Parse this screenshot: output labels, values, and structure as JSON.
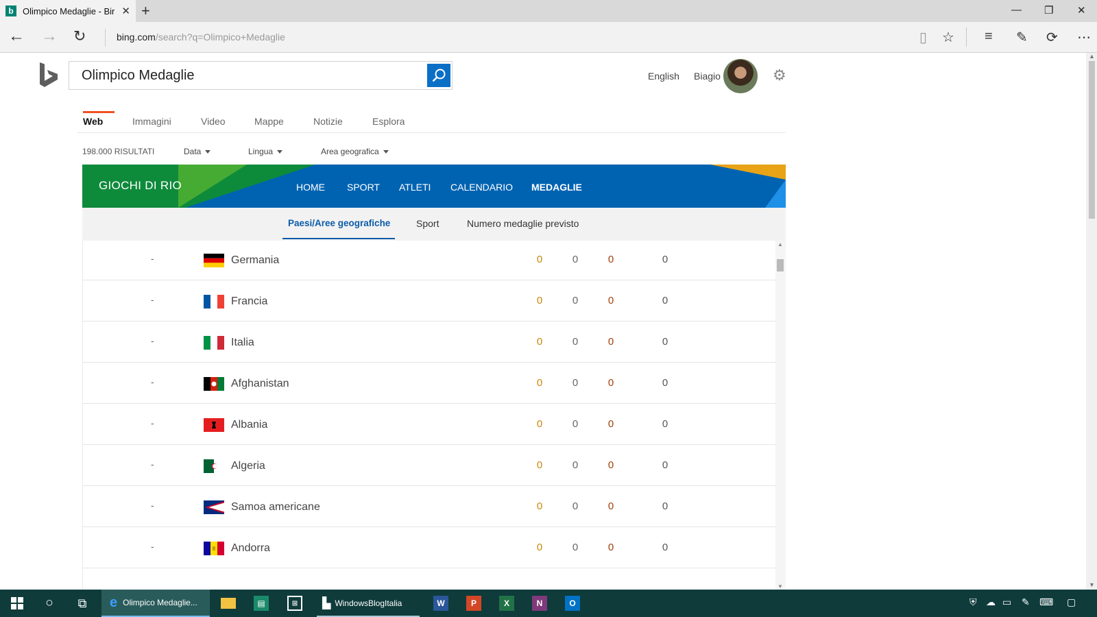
{
  "browser": {
    "tab_title": "Olimpico Medaglie - Bir",
    "url_host": "bing.com",
    "url_path": "/search?q=Olimpico+Medaglie"
  },
  "header": {
    "search_value": "Olimpico Medaglie",
    "language_link": "English",
    "user_name": "Biagio"
  },
  "scopes": [
    "Web",
    "Immagini",
    "Video",
    "Mappe",
    "Notizie",
    "Esplora"
  ],
  "filters": {
    "results_count": "198.000 RISULTATI",
    "date": "Data",
    "language": "Lingua",
    "region": "Area geografica"
  },
  "olympics": {
    "title": "GIOCHI DI RIO",
    "nav": [
      "HOME",
      "SPORT",
      "ATLETI",
      "CALENDARIO",
      "MEDAGLIE"
    ],
    "subtabs": [
      "Paesi/Aree geografiche",
      "Sport",
      "Numero medaglie previsto"
    ],
    "rows": [
      {
        "rank": "-",
        "country": "Germania",
        "gold": "0",
        "silver": "0",
        "bronze": "0",
        "total": "0",
        "flag": "germany"
      },
      {
        "rank": "-",
        "country": "Francia",
        "gold": "0",
        "silver": "0",
        "bronze": "0",
        "total": "0",
        "flag": "france"
      },
      {
        "rank": "-",
        "country": "Italia",
        "gold": "0",
        "silver": "0",
        "bronze": "0",
        "total": "0",
        "flag": "italy"
      },
      {
        "rank": "-",
        "country": "Afghanistan",
        "gold": "0",
        "silver": "0",
        "bronze": "0",
        "total": "0",
        "flag": "afghanistan"
      },
      {
        "rank": "-",
        "country": "Albania",
        "gold": "0",
        "silver": "0",
        "bronze": "0",
        "total": "0",
        "flag": "albania"
      },
      {
        "rank": "-",
        "country": "Algeria",
        "gold": "0",
        "silver": "0",
        "bronze": "0",
        "total": "0",
        "flag": "algeria"
      },
      {
        "rank": "-",
        "country": "Samoa americane",
        "gold": "0",
        "silver": "0",
        "bronze": "0",
        "total": "0",
        "flag": "american-samoa"
      },
      {
        "rank": "-",
        "country": "Andorra",
        "gold": "0",
        "silver": "0",
        "bronze": "0",
        "total": "0",
        "flag": "andorra"
      }
    ]
  },
  "taskbar": {
    "edge_label": "Olimpico Medaglie...",
    "explorer_label": "WindowsBlogItalia"
  },
  "colors": {
    "bing_blue": "#0b6fc6",
    "rio_blue": "#0063b1",
    "rio_green": "#0e8a3b",
    "gold_text": "#c8860a",
    "silver_text": "#666666",
    "bronze_text": "#a0400a",
    "taskbar": "#0f3b3b"
  }
}
